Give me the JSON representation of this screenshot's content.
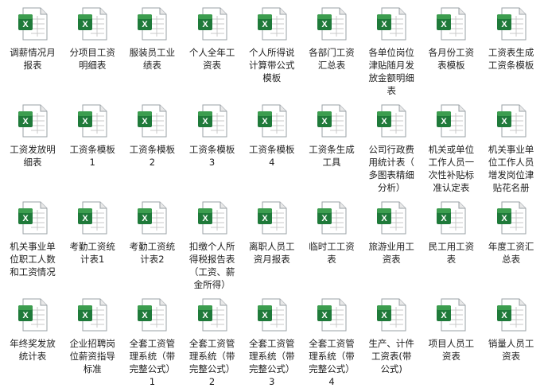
{
  "files": [
    {
      "name": "调薪情况月报表",
      "lines": [
        "调薪情况月",
        "报表"
      ]
    },
    {
      "name": "分项目工资明细表",
      "lines": [
        "分项目工资",
        "明细表"
      ]
    },
    {
      "name": "服装员工业绩表",
      "lines": [
        "服装员工业",
        "绩表"
      ]
    },
    {
      "name": "个人全年工资表",
      "lines": [
        "个人全年工",
        "资表"
      ]
    },
    {
      "name": "个人所得说计算带公式模板",
      "lines": [
        "个人所得说",
        "计算带公式",
        "模板"
      ]
    },
    {
      "name": "各部门工资汇总表",
      "lines": [
        "各部门工资",
        "汇总表"
      ]
    },
    {
      "name": "各单位岗位津贴随月发放金额明细表",
      "lines": [
        "各单位岗位",
        "津贴随月发",
        "放金额明细",
        "表"
      ]
    },
    {
      "name": "各月份工资表模板",
      "lines": [
        "各月份工资",
        "表模板"
      ]
    },
    {
      "name": "工资表生成工资条模板",
      "lines": [
        "工资表生成",
        "工资条模板"
      ]
    },
    {
      "name": "工资发放明细表",
      "lines": [
        "工资发放明",
        "细表"
      ]
    },
    {
      "name": "工资条模板1",
      "lines": [
        "工资条模板",
        "1"
      ]
    },
    {
      "name": "工资条模板2",
      "lines": [
        "工资条模板",
        "2"
      ]
    },
    {
      "name": "工资条模板3",
      "lines": [
        "工资条模板",
        "3"
      ]
    },
    {
      "name": "工资条模板4",
      "lines": [
        "工资条模板",
        "4"
      ]
    },
    {
      "name": "工资条生成工具",
      "lines": [
        "工资条生成",
        "工具"
      ]
    },
    {
      "name": "公司行政费用统计表（多图表精细分析）",
      "lines": [
        "公司行政费",
        "用统计表（",
        "多图表精细",
        "分析）"
      ]
    },
    {
      "name": "机关或单位工作人员一次性补贴标准认定表",
      "lines": [
        "机关或单位",
        "工作人员一",
        "次性补贴标",
        "准认定表"
      ]
    },
    {
      "name": "机关事业单位工作人员增发岗位津贴花名册",
      "lines": [
        "机关事业单",
        "位工作人员",
        "增发岗位津",
        "贴花名册"
      ]
    },
    {
      "name": "机关事业单位职工人数和工资情况",
      "lines": [
        "机关事业单",
        "位职工人数",
        "和工资情况"
      ]
    },
    {
      "name": "考勤工资统计表1",
      "lines": [
        "考勤工资统",
        "计表1"
      ]
    },
    {
      "name": "考勤工资统计表2",
      "lines": [
        "考勤工资统",
        "计表2"
      ]
    },
    {
      "name": "扣缴个人所得税报告表（工资、薪金所得）",
      "lines": [
        "扣缴个人所",
        "得税报告表",
        "（工资、薪",
        "金所得）"
      ]
    },
    {
      "name": "离职人员工资月报表",
      "lines": [
        "离职人员工",
        "资月报表"
      ]
    },
    {
      "name": "临时工工资表",
      "lines": [
        "临时工工资",
        "表"
      ]
    },
    {
      "name": "旅游业用工资表",
      "lines": [
        "旅游业用工",
        "资表"
      ]
    },
    {
      "name": "民工用工资表",
      "lines": [
        "民工用工资",
        "表"
      ]
    },
    {
      "name": "年度工资汇总表",
      "lines": [
        "年度工资汇",
        "总表"
      ]
    },
    {
      "name": "年终奖发放统计表",
      "lines": [
        "年终奖发放",
        "统计表"
      ]
    },
    {
      "name": "企业招聘岗位薪资指导标准",
      "lines": [
        "企业招聘岗",
        "位薪资指导",
        "标准"
      ]
    },
    {
      "name": "全套工资管理系统（带完整公式）1",
      "lines": [
        "全套工资管",
        "理系统（带",
        "完整公式）",
        "1"
      ]
    },
    {
      "name": "全套工资管理系统（带完整公式）2",
      "lines": [
        "全套工资管",
        "理系统（带",
        "完整公式）",
        "2"
      ]
    },
    {
      "name": "全套工资管理系统（带完整公式）3",
      "lines": [
        "全套工资管",
        "理系统（带",
        "完整公式）",
        "3"
      ]
    },
    {
      "name": "全套工资管理系统（带完整公式）4",
      "lines": [
        "全套工资管",
        "理系统（带",
        "完整公式）",
        "4"
      ]
    },
    {
      "name": "生产、计件工资表（带公式）",
      "lines": [
        "生产、计件",
        "工资表(带",
        "公式)"
      ]
    },
    {
      "name": "项目人员工资表",
      "lines": [
        "项目人员工",
        "资表"
      ]
    },
    {
      "name": "销量人员工资表",
      "lines": [
        "销量人员工",
        "资表"
      ]
    }
  ],
  "icon": {
    "name": "excel-file-icon",
    "green": "#1f7a3a",
    "light_green": "#3c9d4f",
    "paper": "#ffffff",
    "grid": "#c9c9c9"
  }
}
